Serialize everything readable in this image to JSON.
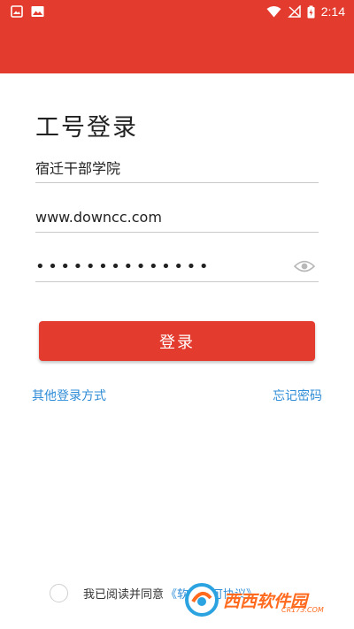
{
  "status_bar": {
    "time": "2:14",
    "left_icons": [
      "image-notification-icon",
      "photo-notification-icon"
    ],
    "right_icons": [
      "wifi-icon",
      "no-signal-icon",
      "battery-charging-icon"
    ]
  },
  "colors": {
    "primary": "#e33b2e",
    "link": "#2f8cd6",
    "watermark": "#ff6a1e"
  },
  "login": {
    "title": "工号登录",
    "org_value": "宿迁干部学院",
    "username_value": "www.downcc.com",
    "password_value": "••••••••••••••",
    "submit_label": "登录",
    "other_login_label": "其他登录方式",
    "forgot_password_label": "忘记密码"
  },
  "agreement": {
    "text": "我已阅读并同意",
    "link_text": "《软件许可协议》"
  },
  "watermark": {
    "text": "西西软件园",
    "sub": "CR173.COM"
  }
}
